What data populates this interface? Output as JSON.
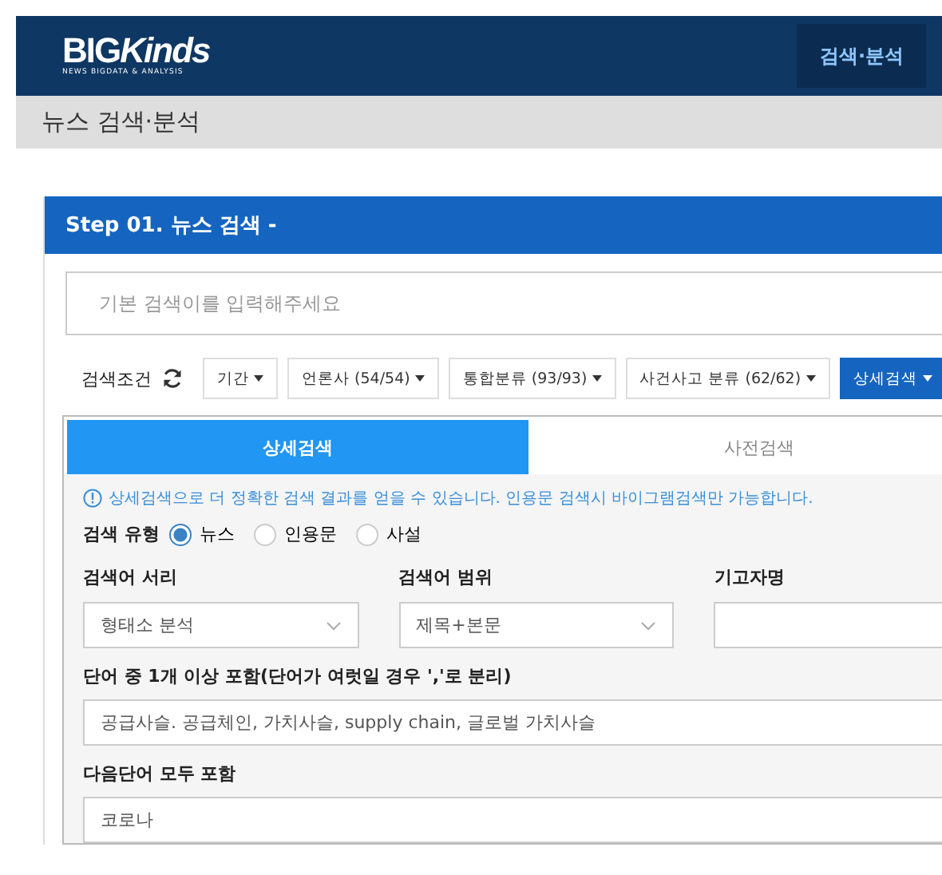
{
  "header": {
    "logo": {
      "main": "BIG",
      "accent": "Kinds",
      "tagline": "NEWS BIGDATA & ANALYSIS"
    },
    "nav": [
      {
        "label": "검색·분석",
        "selected": true
      }
    ]
  },
  "breadcrumb": "뉴스 검색·분석",
  "panel": {
    "title": "Step 01. 뉴스 검색 -",
    "search": {
      "placeholder": "기본 검색이를 입력해주세요"
    },
    "conditions_label": "검색조건",
    "filters": [
      {
        "label": "기간",
        "selected": false
      },
      {
        "label": "언론사 (54/54)",
        "selected": false
      },
      {
        "label": "통합분류 (93/93)",
        "selected": false
      },
      {
        "label": "사건사고 분류 (62/62)",
        "selected": false
      },
      {
        "label": "상세검색",
        "selected": true
      }
    ],
    "tabs": [
      {
        "label": "상세검색",
        "selected": true
      },
      {
        "label": "사전검색",
        "selected": false
      }
    ],
    "info": "상세검색으로 더 정확한 검색 결과를 얻을 수 있습니다. 인용문 검색시 바이그램검색만 가능합니다.",
    "search_type": {
      "label": "검색 유형",
      "options": [
        {
          "label": "뉴스",
          "selected": true
        },
        {
          "label": "인용문",
          "selected": false
        },
        {
          "label": "사설",
          "selected": false
        }
      ]
    },
    "columns": [
      {
        "label": "검색어 서리",
        "kind": "select",
        "value": "형태소 분석"
      },
      {
        "label": "검색어 범위",
        "kind": "select",
        "value": "제목+본문"
      },
      {
        "label": "기고자명",
        "kind": "input"
      }
    ],
    "fields": [
      {
        "label": "단어 중 1개 이상 포함(단어가 여럿일 경우 ','로 분리)",
        "value": "공급사슬. 공급체인, 가치사슬, supply chain, 글로벌 가치사슬"
      },
      {
        "label": "다음단어 모두 포함",
        "value": "코로나"
      }
    ]
  }
}
